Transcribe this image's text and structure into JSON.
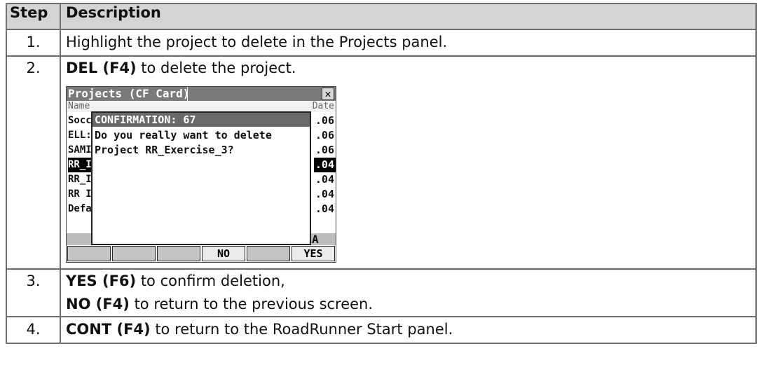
{
  "table": {
    "headers": {
      "step": "Step",
      "description": "Description"
    },
    "rows": [
      {
        "num": "1.",
        "lines": [
          {
            "bold": "",
            "text": "Highlight the project to delete in the Projects panel."
          }
        ]
      },
      {
        "num": "2.",
        "lines": [
          {
            "bold": "DEL (F4)",
            "text": " to delete the project."
          }
        ]
      },
      {
        "num": "3.",
        "lines": [
          {
            "bold": "YES (F6)",
            "text": " to confirm deletion,"
          },
          {
            "bold": "NO (F4)",
            "text": " to return to the previous screen."
          }
        ]
      },
      {
        "num": "4.",
        "lines": [
          {
            "bold": "CONT (F4)",
            "text": " to return to the RoadRunner Start panel."
          }
        ]
      }
    ]
  },
  "screen": {
    "title": "Projects (CF Card)",
    "close_glyph": "✕",
    "col_name": "Name",
    "col_date": "Date",
    "projects": [
      {
        "name": "Socc",
        "date": ".06",
        "selected": false
      },
      {
        "name": "ELL:",
        "date": ".06",
        "selected": false
      },
      {
        "name": "SAMI",
        "date": ".06",
        "selected": false
      },
      {
        "name": "RR_I",
        "date": ".04",
        "selected": true
      },
      {
        "name": "RR_I",
        "date": ".04",
        "selected": false
      },
      {
        "name": "RR I",
        "date": ".04",
        "selected": false
      },
      {
        "name": "Defa",
        "date": ".04",
        "selected": false
      }
    ],
    "page_indicator": "A",
    "fkeys": [
      "",
      "",
      "",
      "NO",
      "",
      "YES"
    ],
    "dialog": {
      "title": "CONFIRMATION: 67",
      "line1": "Do you really want to delete",
      "line2": "Project RR_Exercise_3?"
    }
  }
}
